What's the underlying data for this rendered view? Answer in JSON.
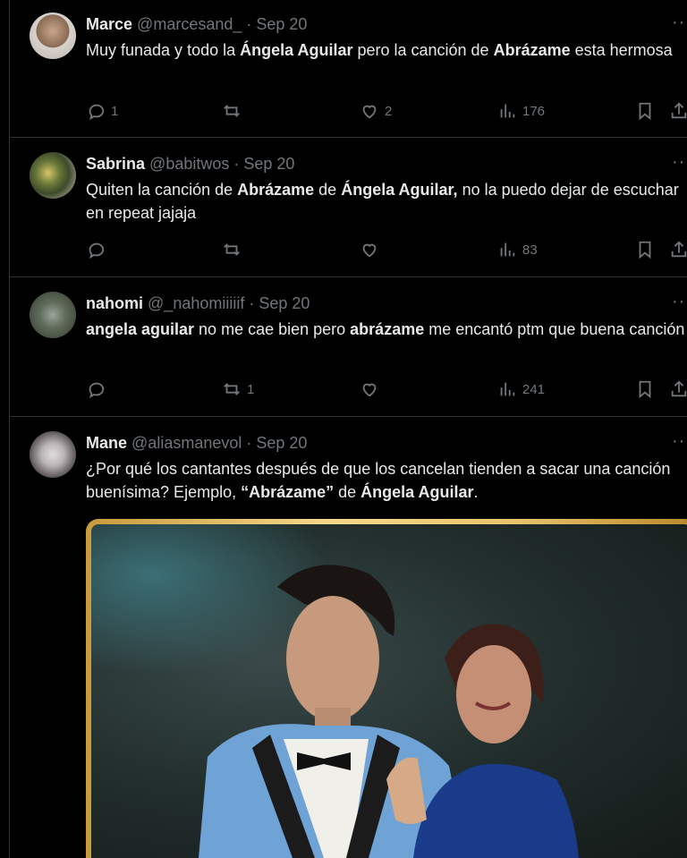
{
  "tweets": [
    {
      "name": "Marce",
      "handle": "@marcesand_",
      "sep": " · ",
      "date": "Sep 20",
      "text": [
        {
          "t": "Muy funada y todo la ",
          "b": false
        },
        {
          "t": "Ángela Aguilar",
          "b": true
        },
        {
          "t": " pero la canción de ",
          "b": false
        },
        {
          "t": "Abrázame",
          "b": true
        },
        {
          "t": " esta hermosa",
          "b": false
        }
      ],
      "replies": "1",
      "retweets": "",
      "likes": "2",
      "views": "176"
    },
    {
      "name": "Sabrina",
      "handle": "@babitwos",
      "sep": " · ",
      "date": "Sep 20",
      "text": [
        {
          "t": "Quiten la canción de ",
          "b": false
        },
        {
          "t": "Abrázame",
          "b": true
        },
        {
          "t": " de ",
          "b": false
        },
        {
          "t": "Ángela Aguilar,",
          "b": true
        },
        {
          "t": " no la puedo dejar de escuchar en repeat jajaja",
          "b": false
        }
      ],
      "replies": "",
      "retweets": "",
      "likes": "",
      "views": "83"
    },
    {
      "name": "nahomi",
      "handle": "@_nahomiiiiif",
      "sep": " · ",
      "date": "Sep 20",
      "text": [
        {
          "t": "angela aguilar",
          "b": true
        },
        {
          "t": " no me cae bien pero ",
          "b": false
        },
        {
          "t": "abrázame",
          "b": true
        },
        {
          "t": " me encantó ptm que buena canción",
          "b": false
        }
      ],
      "replies": "",
      "retweets": "1",
      "likes": "",
      "views": "241"
    },
    {
      "name": "Mane",
      "handle": "@aliasmanevol",
      "sep": " · ",
      "date": "Sep 20",
      "text": [
        {
          "t": "¿Por qué los cantantes después de que los cancelan tienden a sacar una canción buenísima? Ejemplo, ",
          "b": false
        },
        {
          "t": "“Abrázame”",
          "b": true
        },
        {
          "t": " de ",
          "b": false
        },
        {
          "t": "Ángela Aguilar",
          "b": true
        },
        {
          "t": ".",
          "b": false
        }
      ],
      "replies": "",
      "retweets": "",
      "likes": "",
      "views": ""
    }
  ],
  "more_label": "···",
  "colors": {
    "background": "#000000",
    "text": "#e7e9ea",
    "muted": "#71767b",
    "divider": "#2f3336",
    "frame_gold": "#e8c46a"
  },
  "icons": [
    "reply-icon",
    "retweet-icon",
    "like-icon",
    "views-icon",
    "bookmark-icon",
    "share-icon"
  ]
}
